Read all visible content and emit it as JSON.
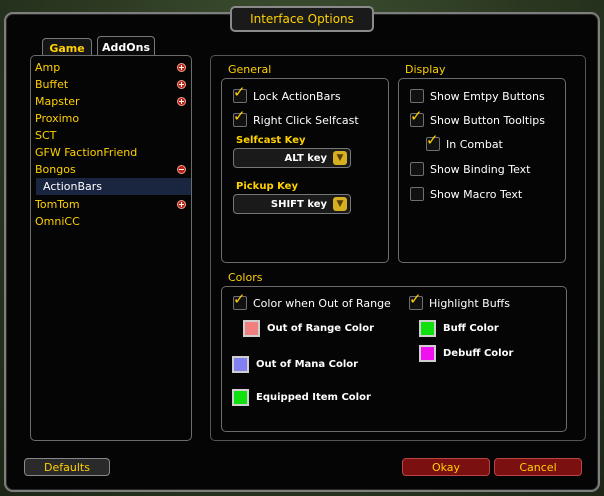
{
  "window": {
    "title": "Interface Options"
  },
  "tabs": [
    {
      "label": "Game",
      "active": false
    },
    {
      "label": "AddOns",
      "active": true
    }
  ],
  "addons": [
    {
      "label": "Amp",
      "toggle": "plus"
    },
    {
      "label": "Buffet",
      "toggle": "plus"
    },
    {
      "label": "Mapster",
      "toggle": "plus"
    },
    {
      "label": "Proximo",
      "toggle": ""
    },
    {
      "label": "SCT",
      "toggle": ""
    },
    {
      "label": "GFW FactionFriend",
      "toggle": ""
    },
    {
      "label": "Bongos",
      "toggle": "minus"
    },
    {
      "label": "ActionBars",
      "toggle": "",
      "sub": true,
      "selected": true
    },
    {
      "label": "TomTom",
      "toggle": "plus"
    },
    {
      "label": "OmniCC",
      "toggle": ""
    }
  ],
  "general": {
    "title": "General",
    "lock_actionbars": {
      "label": "Lock ActionBars",
      "checked": true
    },
    "right_click_selfcast": {
      "label": "Right Click Selfcast",
      "checked": true
    },
    "selfcast_key": {
      "label": "Selfcast Key",
      "value": "ALT key"
    },
    "pickup_key": {
      "label": "Pickup Key",
      "value": "SHIFT key"
    }
  },
  "display": {
    "title": "Display",
    "show_empty_buttons": {
      "label": "Show Emtpy Buttons",
      "checked": false
    },
    "show_button_tooltips": {
      "label": "Show Button Tooltips",
      "checked": true
    },
    "in_combat": {
      "label": "In Combat",
      "checked": true
    },
    "show_binding_text": {
      "label": "Show Binding Text",
      "checked": false
    },
    "show_macro_text": {
      "label": "Show Macro Text",
      "checked": false
    }
  },
  "colors": {
    "title": "Colors",
    "color_when_out_of_range": {
      "label": "Color when Out of Range",
      "checked": true
    },
    "highlight_buffs": {
      "label": "Highlight Buffs",
      "checked": true
    },
    "out_of_range_color": {
      "label": "Out of Range Color",
      "color": "#f08080"
    },
    "out_of_mana_color": {
      "label": "Out of Mana Color",
      "color": "#8080f0"
    },
    "equipped_item_color": {
      "label": "Equipped Item Color",
      "color": "#10e010"
    },
    "buff_color": {
      "label": "Buff Color",
      "color": "#10e010"
    },
    "debuff_color": {
      "label": "Debuff Color",
      "color": "#f010f0"
    }
  },
  "buttons": {
    "defaults": "Defaults",
    "okay": "Okay",
    "cancel": "Cancel"
  },
  "theme": {
    "accent": "#ffd100"
  }
}
